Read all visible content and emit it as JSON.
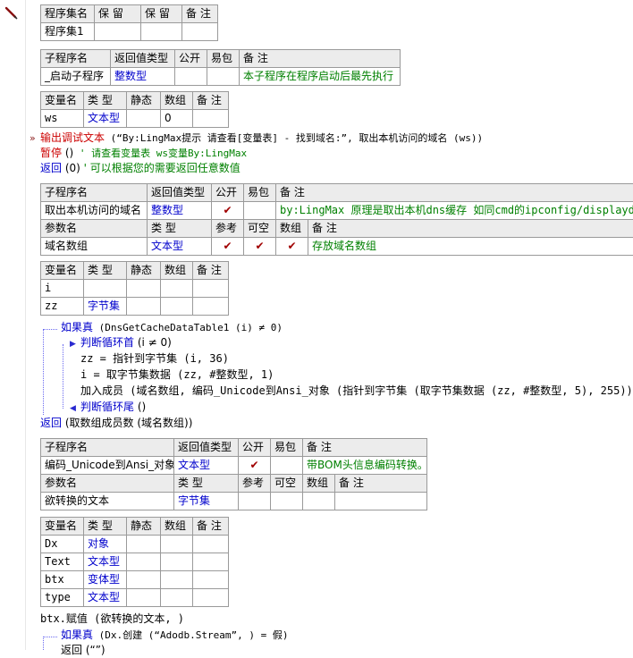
{
  "program_set_table": {
    "headers": [
      "程序集名",
      "保 留",
      "保 留",
      "备 注"
    ],
    "row": [
      "程序集1",
      "",
      "",
      ""
    ]
  },
  "startup_sub_table": {
    "headers": [
      "子程序名",
      "返回值类型",
      "公开",
      "易包",
      "备 注"
    ],
    "row": {
      "name": "_启动子程序",
      "return_type": "整数型",
      "public": "",
      "easy_pack": "",
      "note": "本子程序在程序启动后最先执行"
    }
  },
  "startup_vars_table": {
    "headers": [
      "变量名",
      "类 型",
      "静态",
      "数组",
      "备 注"
    ],
    "rows": [
      [
        "ws",
        "文本型",
        "",
        "0",
        ""
      ]
    ]
  },
  "startup_code": {
    "line1_call": "输出调试文本",
    "line1_args": " (“By:LingMax提示 请查看[变量表] - 找到域名:”, 取出本机访问的域名 (ws))",
    "line2_call": "暂停",
    "line2_args": " ()",
    "line2_comment": "  ' 请查看变量表 ws变量By:LingMax",
    "line3_call": "返回",
    "line3_args": " (0)",
    "line3_comment": "  ' 可以根据您的需要返回任意数值"
  },
  "domain_sub_table": {
    "headers": [
      "子程序名",
      "返回值类型",
      "公开",
      "易包",
      "备 注"
    ],
    "row": {
      "name": "取出本机访问的域名",
      "return_type": "整数型",
      "public_check": "✔",
      "easy_pack": "",
      "note": "by:LingMax  原理是取出本机dns缓存 如同cmd的ipconfig/displaydns 命令"
    },
    "param_headers": [
      "参数名",
      "类 型",
      "参考",
      "可空",
      "数组",
      "备 注"
    ],
    "param_row": {
      "name": "域名数组",
      "type": "文本型",
      "ref": "✔",
      "nullable": "✔",
      "array": "✔",
      "note": "存放域名数组"
    }
  },
  "domain_vars_table": {
    "headers": [
      "变量名",
      "类 型",
      "静态",
      "数组",
      "备 注"
    ],
    "rows": [
      [
        "i",
        "",
        "",
        "",
        ""
      ],
      [
        "zz",
        "字节集",
        "",
        "",
        ""
      ]
    ]
  },
  "domain_code": {
    "if_keyword": "如果真",
    "if_args": " (DnsGetCacheDataTable1 (i) ≠ 0)",
    "loop_keyword": "判断循环首",
    "loop_args": " (i ≠ 0)",
    "zz_line": "zz = 指针到字节集 (i, 36)",
    "i_line": "i = 取字节集数据 (zz, #整数型, 1)",
    "add_line": "加入成员 (域名数组, 编码_Unicode到Ansi_对象 (指针到字节集 (取字节集数据 (zz, #整数型, 5), 255)))",
    "loop_end": "判断循环尾",
    "loop_end_args": " ()",
    "return_call": "返回",
    "return_args": " (取数组成员数 (域名数组))"
  },
  "encode_sub_table": {
    "headers": [
      "子程序名",
      "返回值类型",
      "公开",
      "易包",
      "备 注"
    ],
    "row": {
      "name": "编码_Unicode到Ansi_对象",
      "return_type": "文本型",
      "public_check": "✔",
      "easy_pack": "",
      "note": "带BOM头信息编码转换。"
    },
    "param_headers": [
      "参数名",
      "类 型",
      "参考",
      "可空",
      "数组",
      "备 注"
    ],
    "param_row": {
      "name": "欲转换的文本",
      "type": "字节集",
      "ref": "",
      "nullable": "",
      "array": "",
      "note": ""
    }
  },
  "encode_vars_table": {
    "headers": [
      "变量名",
      "类 型",
      "静态",
      "数组",
      "备 注"
    ],
    "rows": [
      [
        "Dx",
        "对象",
        "",
        "",
        ""
      ],
      [
        "Text",
        "文本型",
        "",
        "",
        ""
      ],
      [
        "btx",
        "变体型",
        "",
        "",
        ""
      ],
      [
        "type",
        "文本型",
        "",
        "",
        ""
      ]
    ]
  },
  "encode_code": {
    "assign_line": "btx.赋值 (欲转换的文本, )",
    "if_keyword": "如果真",
    "if_args": " (Dx.创建 (“Adodb.Stream”, ) = 假)",
    "return_partial": "返回 (“”)"
  }
}
